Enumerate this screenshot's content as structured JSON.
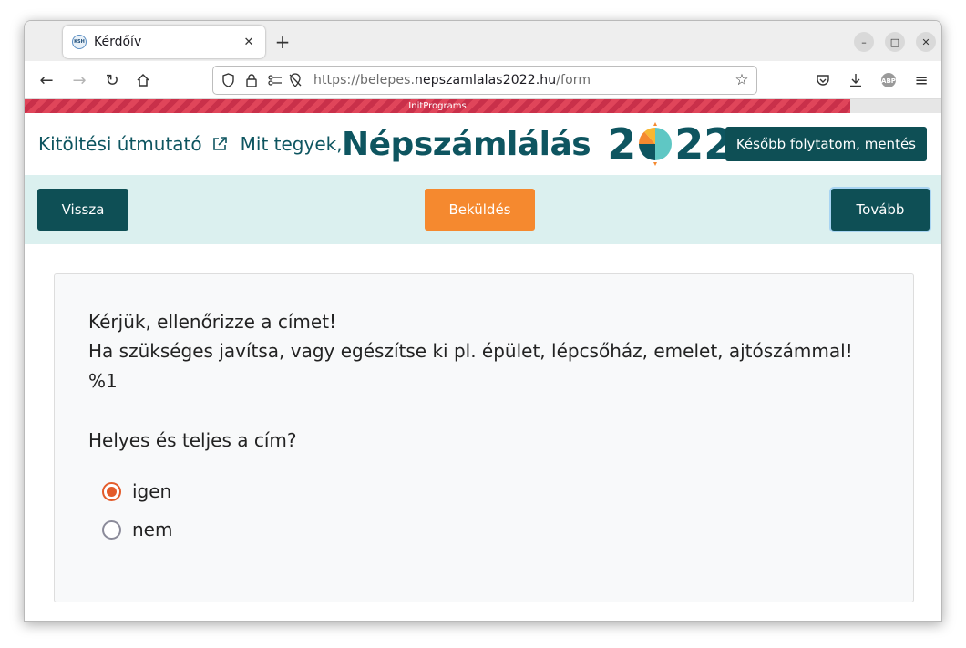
{
  "browser": {
    "tab_title": "Kérdőív",
    "favicon_text": "KSH",
    "url_prefix": "https://belepes.",
    "url_host": "nepszamlalas2022.hu",
    "url_path": "/form"
  },
  "banner": {
    "text": "InitPrograms"
  },
  "header": {
    "guide_link": "Kitöltési útmutató",
    "help_link": "Mit tegyek, ha elakadtam?",
    "logo_text": "Népszámlálás",
    "logo_year_left": "2",
    "logo_year_right": "22",
    "save_button": "Később folytatom, mentés"
  },
  "actions": {
    "back": "Vissza",
    "submit": "Beküldés",
    "next": "Tovább"
  },
  "question": {
    "line1": "Kérjük, ellenőrizze a címet!",
    "line2": "Ha szükséges javítsa, vagy egészítse ki pl. épület, lépcsőház, emelet, ajtószámmal!",
    "line3": "%1",
    "prompt": "Helyes és teljes a cím?",
    "options": [
      {
        "label": "igen",
        "checked": true
      },
      {
        "label": "nem",
        "checked": false
      }
    ]
  },
  "colors": {
    "brand_dark": "#0e4f55",
    "brand_text": "#0e5560",
    "accent_orange": "#f5892f",
    "action_bar_bg": "#dbf0ef",
    "radio_checked": "#e35b2a"
  }
}
